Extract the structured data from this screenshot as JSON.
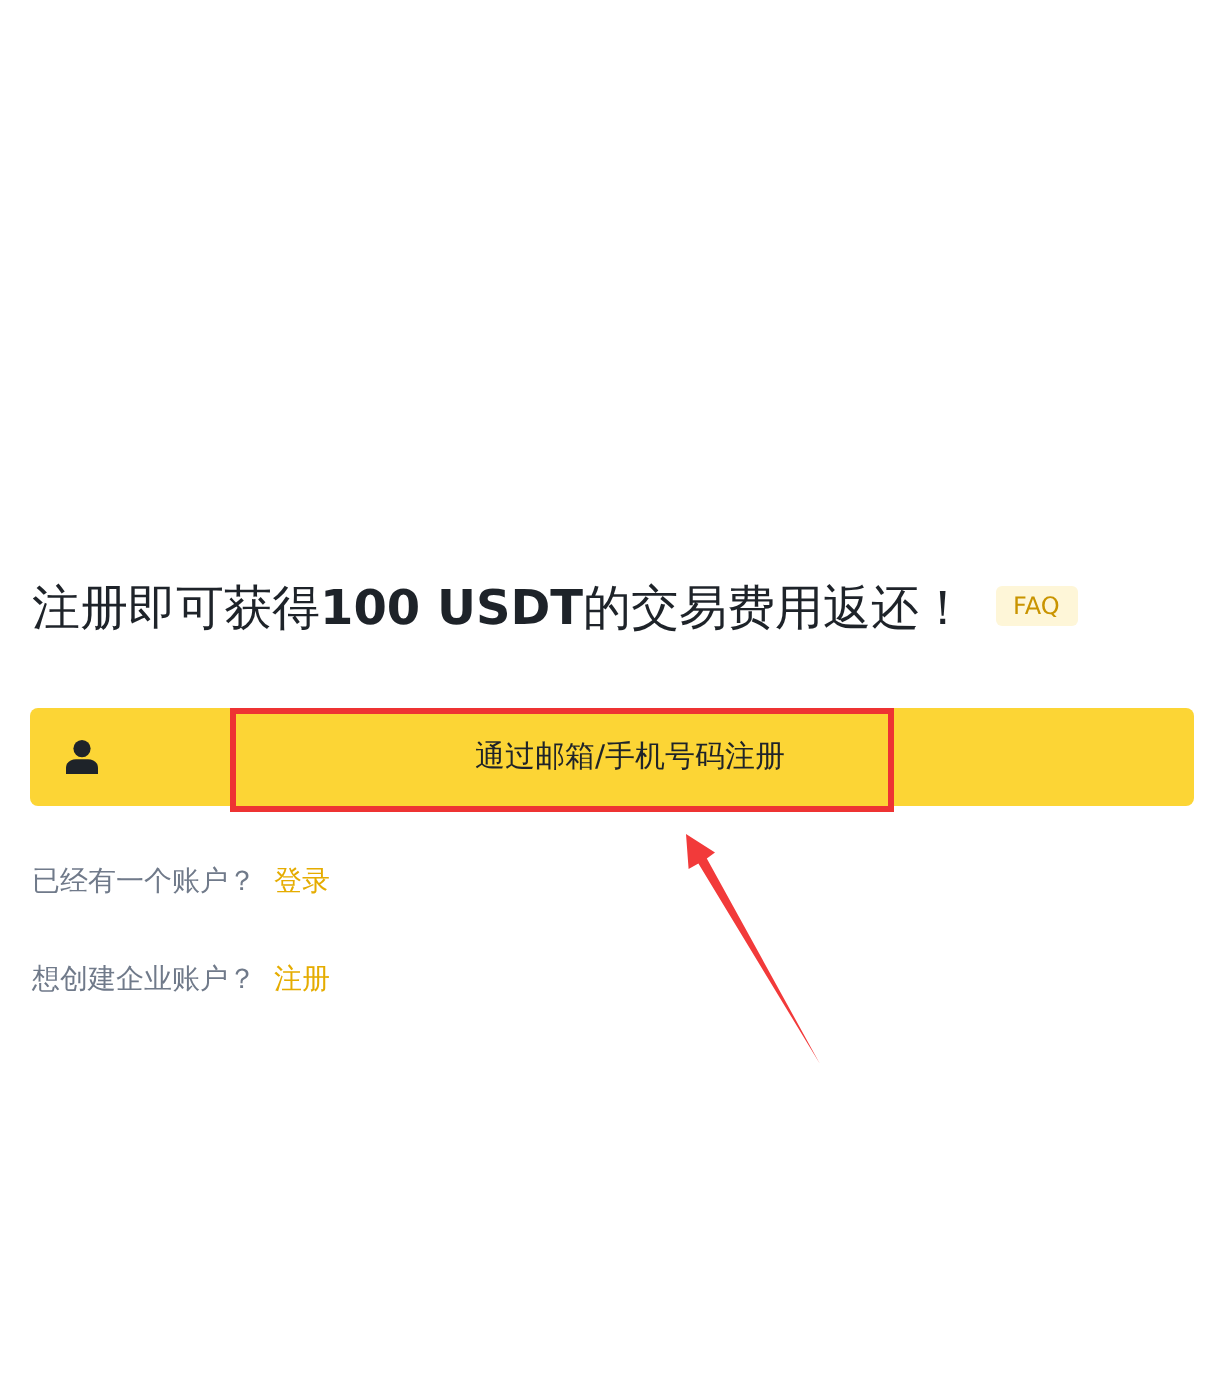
{
  "heading": {
    "text": "注册即可获得**100 USDT**的交易费用返还！",
    "badge": "FAQ"
  },
  "signup_button": {
    "label": "通过邮箱/手机号码注册",
    "highlighted": true
  },
  "links": [
    {
      "prompt": "已经有一个账户？",
      "link": "登录"
    },
    {
      "prompt": "想创建企业账户？",
      "link": "注册"
    }
  ]
}
